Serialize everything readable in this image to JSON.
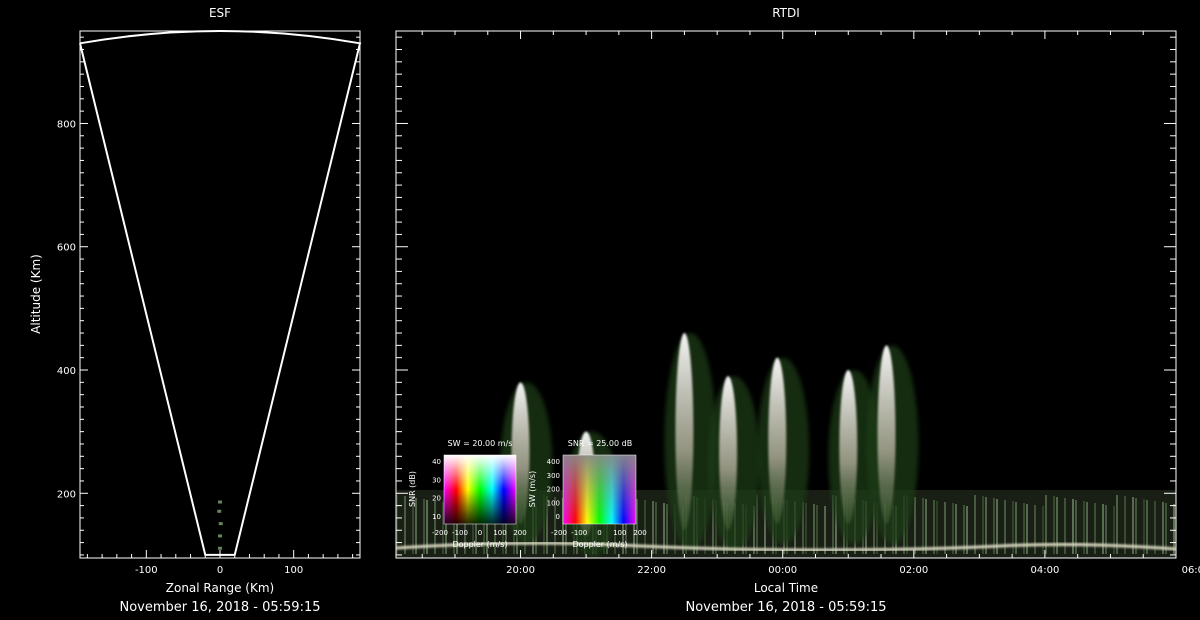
{
  "chart_data": [
    {
      "type": "scatter",
      "title": "ESF",
      "xlabel": "Zonal Range (Km)",
      "ylabel": "Altitude (Km)",
      "footer": "November 16, 2018 - 05:59:15",
      "xlim": [
        -190,
        190
      ],
      "ylim": [
        95,
        950
      ],
      "xticks": [
        -100,
        0,
        100
      ],
      "yticks": [
        200,
        400,
        600,
        800
      ],
      "fan_outline": [
        [
          -190,
          930
        ],
        [
          -20,
          100
        ],
        [
          20,
          100
        ],
        [
          190,
          930
        ]
      ],
      "fan_arc_top_altitude": 950,
      "echoes": [
        {
          "x": 0,
          "y": 110
        },
        {
          "x": 0,
          "y": 130
        },
        {
          "x": 1,
          "y": 150
        },
        {
          "x": -1,
          "y": 170
        },
        {
          "x": 0,
          "y": 185
        }
      ],
      "grid": false
    },
    {
      "type": "heatmap",
      "title": "RTDI",
      "xlabel": "Local Time",
      "footer": "November 16, 2018 - 05:59:15",
      "xlim": [
        "18:06",
        "06:00"
      ],
      "ylim": [
        95,
        950
      ],
      "xticks": [
        "20:00",
        "22:00",
        "00:00",
        "02:00",
        "04:00",
        "06:00"
      ],
      "yticks": [
        200,
        400,
        600,
        800
      ],
      "plumes": [
        {
          "time": "20:00",
          "alt_top": 380,
          "alt_bottom": 150
        },
        {
          "time": "21:00",
          "alt_top": 300,
          "alt_bottom": 130
        },
        {
          "time": "22:30",
          "alt_top": 460,
          "alt_bottom": 140
        },
        {
          "time": "23:10",
          "alt_top": 390,
          "alt_bottom": 140
        },
        {
          "time": "23:55",
          "alt_top": 420,
          "alt_bottom": 150
        },
        {
          "time": "01:00",
          "alt_top": 400,
          "alt_bottom": 150
        },
        {
          "time": "01:35",
          "alt_top": 440,
          "alt_bottom": 150
        }
      ],
      "grid": false
    }
  ],
  "legends": [
    {
      "title": "SW = 20.00 m/s",
      "xlabel": "Doppler (m/s)",
      "ylabel": "SNR (dB)",
      "xticks": [
        "-200",
        "-100",
        "0",
        "100",
        "200"
      ],
      "yticks": [
        "10",
        "20",
        "30",
        "40"
      ]
    },
    {
      "title": "SNR = 25.00 dB",
      "xlabel": "Doppler (m/s)",
      "ylabel": "SW (m/s)",
      "xticks": [
        "-200",
        "-100",
        "0",
        "100",
        "200"
      ],
      "yticks": [
        "0",
        "100",
        "200",
        "300",
        "400"
      ]
    }
  ],
  "colors": {
    "background": "#000000",
    "axes": "#ffffff",
    "echo": "#8fbf7a",
    "plume": "#e8e0d8"
  }
}
